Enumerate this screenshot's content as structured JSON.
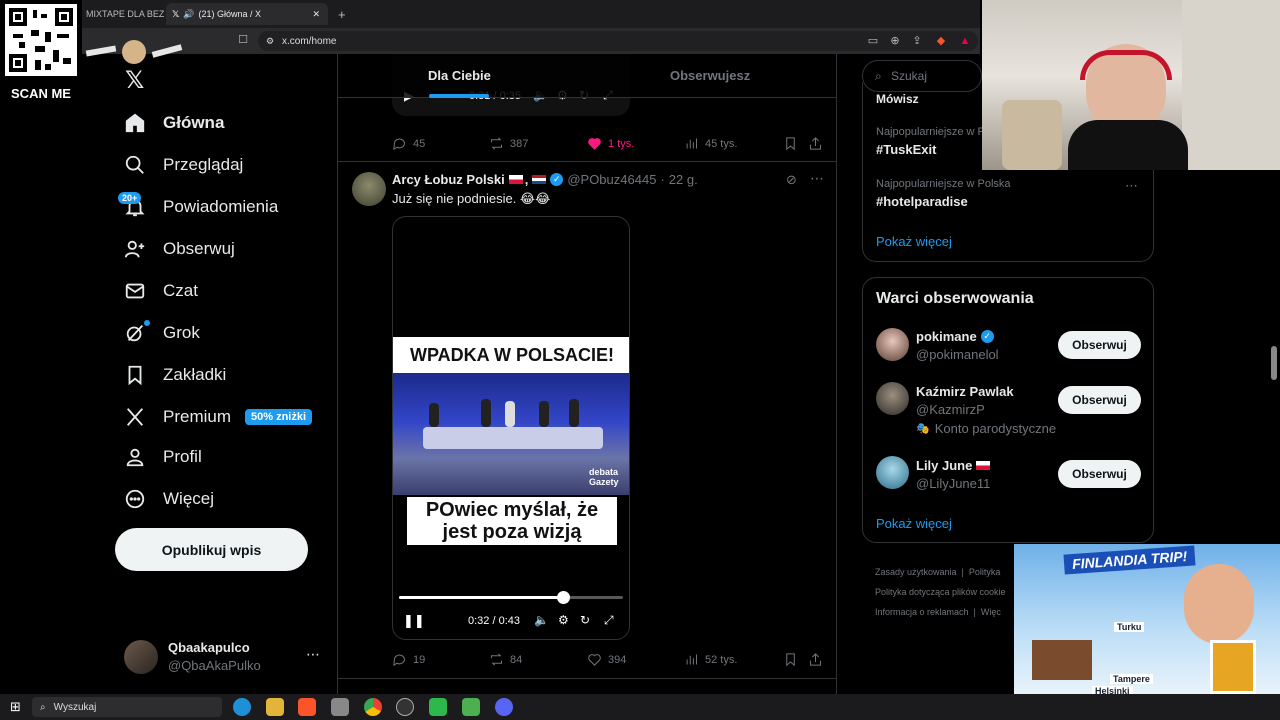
{
  "browser": {
    "tabs": [
      {
        "label": "MIXTAPE DLA BEZRO"
      },
      {
        "label": "(21) Główna / X"
      }
    ],
    "url": "x.com/home"
  },
  "overlay": {
    "qr_caption": "SCAN ME",
    "promo_title": "FINLANDIA TRIP!",
    "promo_cities": [
      "Turku",
      "Tampere",
      "Helsinki"
    ]
  },
  "nav": {
    "items": [
      {
        "label": "Główna"
      },
      {
        "label": "Przeglądaj"
      },
      {
        "label": "Powiadomienia",
        "badge": "20+"
      },
      {
        "label": "Obserwuj"
      },
      {
        "label": "Czat"
      },
      {
        "label": "Grok"
      },
      {
        "label": "Zakładki"
      },
      {
        "label": "Premium",
        "badge": "50% zniżki"
      },
      {
        "label": "Profil"
      },
      {
        "label": "Więcej"
      }
    ],
    "publish_label": "Opublikuj wpis",
    "account": {
      "name": "Qbaakapulco",
      "handle": "@QbaAkaPulko"
    }
  },
  "feed": {
    "tabs": [
      "Dla Ciebie",
      "Obserwujesz"
    ],
    "prev_post": {
      "video_time": "0:31 / 0:35",
      "replies": "45",
      "reposts": "387",
      "likes": "1 tys.",
      "views": "45 tys."
    },
    "post": {
      "author": "Arcy Łobuz Polski",
      "handle": "@PObuz46445",
      "time": "22 g.",
      "text": "Już się nie podniesie. 😂😂",
      "video_headline": "WPADKA W POLSACIE!",
      "video_caption": "POwiec myślał, że jest poza wizją",
      "video_brand": "debata Gazety",
      "video_time": "0:32 / 0:43",
      "progress": 0.73,
      "replies": "19",
      "reposts": "84",
      "likes": "394",
      "views": "52 tys."
    }
  },
  "right": {
    "search_placeholder": "Szukaj",
    "trends": [
      {
        "context": "",
        "title": "Mówisz"
      },
      {
        "context": "Najpopularniejsze w P",
        "title": "#TuskExit"
      },
      {
        "context": "Najpopularniejsze w Polska",
        "title": "#hotelparadise"
      }
    ],
    "show_more": "Pokaż więcej",
    "who_to_follow_title": "Warci obserwowania",
    "who_to_follow": [
      {
        "name": "pokimane",
        "handle": "@pokimanelol",
        "note": "",
        "button": "Obserwuj"
      },
      {
        "name": "Kaźmirz Pawlak",
        "handle": "@KazmirzP",
        "note": "Konto parodystyczne",
        "button": "Obserwuj"
      },
      {
        "name": "Lily June",
        "handle": "@LilyJune11",
        "note": "",
        "button": "Obserwuj"
      }
    ],
    "footer": [
      "Zasady użytkowania",
      "Polityka",
      "Polityka dotycząca plików cookie",
      "Informacja o reklamach",
      "Więc"
    ]
  },
  "taskbar": {
    "search": "Wyszukaj"
  },
  "colors": {
    "accent": "#1d9bf0",
    "like": "#f91880",
    "bg": "#000000"
  }
}
